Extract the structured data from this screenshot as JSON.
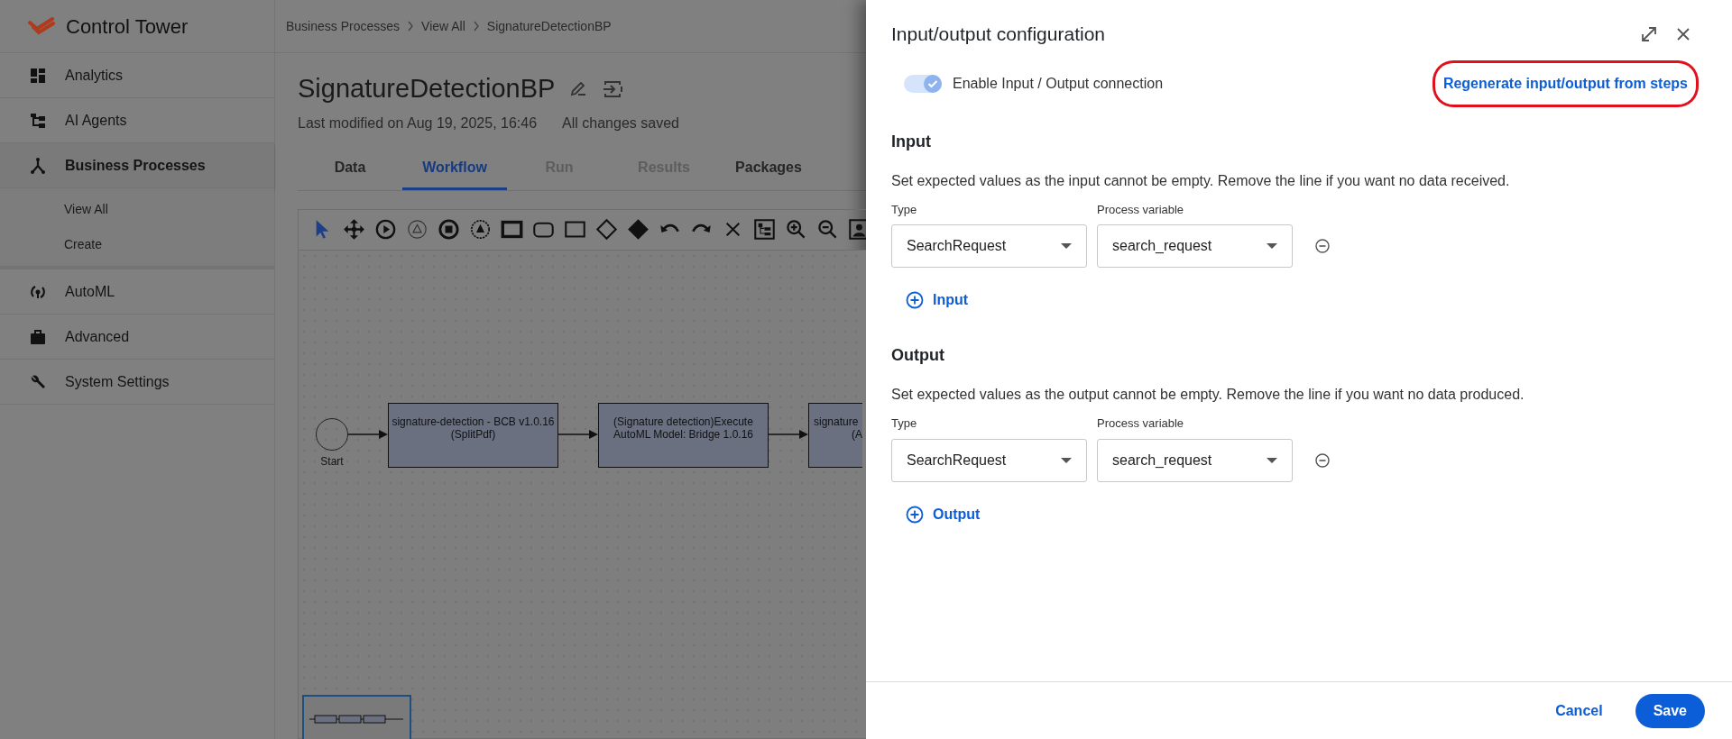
{
  "app": {
    "name": "Control Tower"
  },
  "sidebar": {
    "items": [
      {
        "label": "Analytics",
        "selected": false
      },
      {
        "label": "AI Agents",
        "selected": false
      },
      {
        "label": "Business Processes",
        "selected": true,
        "expanded": true,
        "children": [
          {
            "label": "View All"
          },
          {
            "label": "Create"
          }
        ]
      },
      {
        "label": "AutoML",
        "selected": false
      },
      {
        "label": "Advanced",
        "selected": false
      },
      {
        "label": "System Settings",
        "selected": false
      }
    ]
  },
  "breadcrumb": [
    "Business Processes",
    "View All",
    "SignatureDetectionBP"
  ],
  "process": {
    "title": "SignatureDetectionBP",
    "modified": "Last modified on Aug 19, 2025, 16:46",
    "save_status": "All changes saved"
  },
  "tabs": [
    {
      "label": "Data",
      "selected": false,
      "disabled": false
    },
    {
      "label": "Workflow",
      "selected": true,
      "disabled": false
    },
    {
      "label": "Run",
      "selected": false,
      "disabled": true
    },
    {
      "label": "Results",
      "selected": false,
      "disabled": true
    },
    {
      "label": "Packages",
      "selected": false,
      "disabled": false
    }
  ],
  "workflow": {
    "nodes": [
      {
        "kind": "start",
        "lines": [
          "Start"
        ]
      },
      {
        "kind": "task",
        "lines": [
          "signature-detection - BCB v1.0.16",
          "(SplitPdf)"
        ]
      },
      {
        "kind": "task",
        "lines": [
          "(Signature detection)Execute",
          "AutoML Model: Bridge 1.0.16"
        ]
      },
      {
        "kind": "task",
        "lines": [
          "signature",
          "(A"
        ]
      }
    ]
  },
  "dialog": {
    "title": "Input/output configuration",
    "toggle": {
      "label": "Enable Input / Output connection",
      "on": true
    },
    "regenerate_link": {
      "label": "Regenerate input/output from steps",
      "highlighted": true
    },
    "sections": [
      {
        "heading": "Input",
        "description": "Set expected values as the input cannot be empty. Remove the line if you want no data received.",
        "columns": [
          "Type",
          "Process variable"
        ],
        "rows": [
          {
            "type": "SearchRequest",
            "variable": "search_request"
          }
        ],
        "add_label": "Input"
      },
      {
        "heading": "Output",
        "description": "Set expected values as the output cannot be empty. Remove the line if you want no data produced.",
        "columns": [
          "Type",
          "Process variable"
        ],
        "rows": [
          {
            "type": "SearchRequest",
            "variable": "search_request"
          }
        ],
        "add_label": "Output"
      }
    ],
    "buttons": [
      {
        "kind": "secondary",
        "label": "Cancel"
      },
      {
        "kind": "primary",
        "label": "Save"
      }
    ]
  }
}
